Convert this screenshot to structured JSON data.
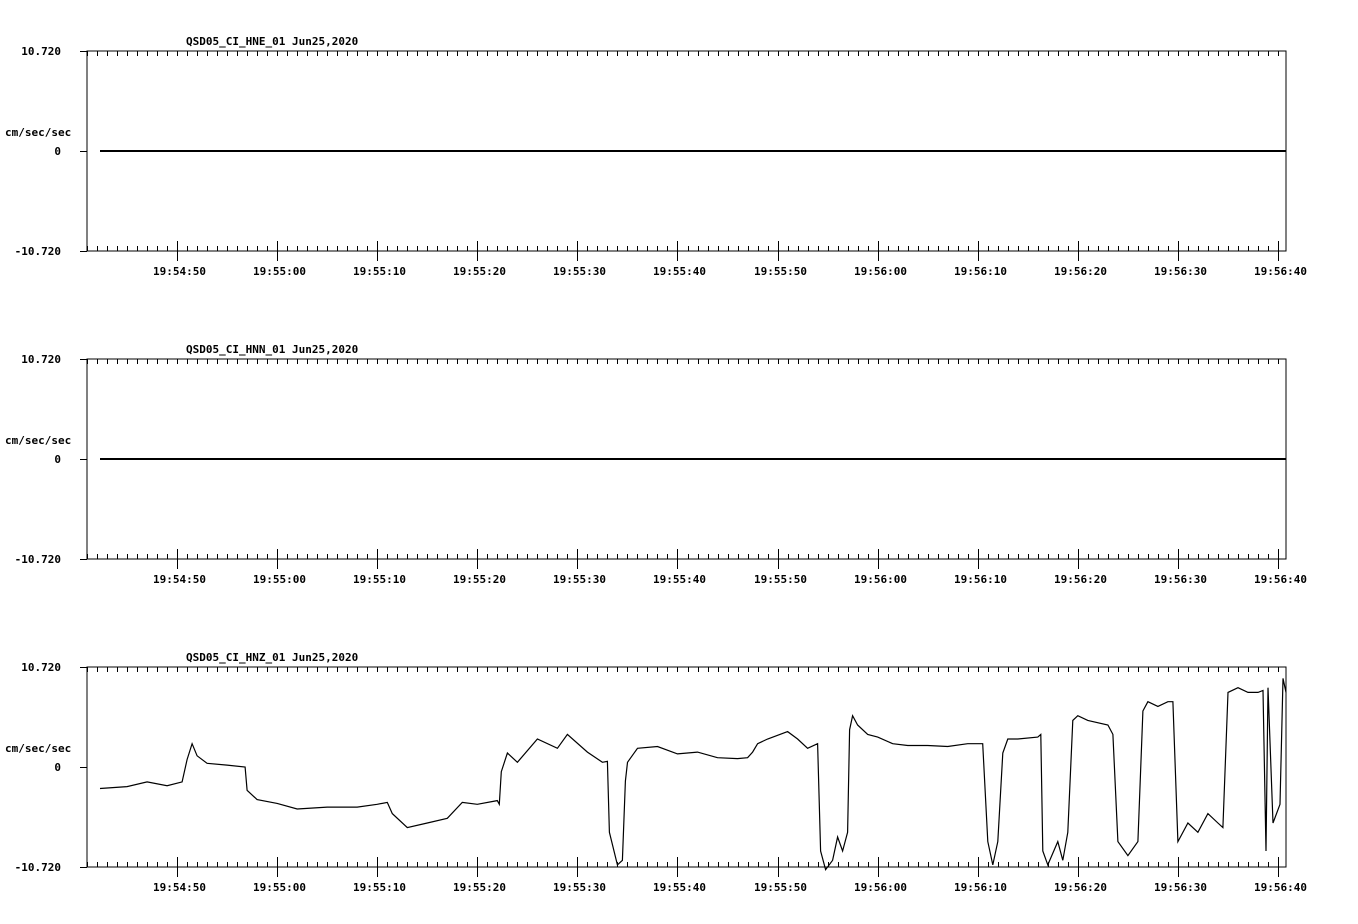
{
  "chart_data": [
    {
      "type": "line",
      "title": "QSD05_CI_HNE_01  Jun25,2020",
      "ylabel": "cm/sec/sec",
      "ylim": [
        -10.72,
        10.72
      ],
      "ytick_labels": [
        "10.720",
        "0",
        "-10.720"
      ],
      "xlim_seconds": [
        -9.0,
        110.8
      ],
      "xtick_labels": [
        "19:54:50",
        "19:55:00",
        "19:55:10",
        "19:55:20",
        "19:55:30",
        "19:55:40",
        "19:55:50",
        "19:56:00",
        "19:56:10",
        "19:56:20",
        "19:56:30",
        "19:56:40"
      ],
      "series": [
        {
          "points": [
            [
              -7.7,
              0
            ],
            [
              110.8,
              0
            ]
          ]
        }
      ]
    },
    {
      "type": "line",
      "title": "QSD05_CI_HNN_01  Jun25,2020",
      "ylabel": "cm/sec/sec",
      "ylim": [
        -10.72,
        10.72
      ],
      "ytick_labels": [
        "10.720",
        "0",
        "-10.720"
      ],
      "xlim_seconds": [
        -9.0,
        110.8
      ],
      "xtick_labels": [
        "19:54:50",
        "19:55:00",
        "19:55:10",
        "19:55:20",
        "19:55:30",
        "19:55:40",
        "19:55:50",
        "19:56:00",
        "19:56:10",
        "19:56:20",
        "19:56:30",
        "19:56:40"
      ],
      "series": [
        {
          "points": [
            [
              -7.7,
              0
            ],
            [
              110.8,
              0
            ]
          ]
        }
      ]
    },
    {
      "type": "line",
      "title": "QSD05_CI_HNZ_01  Jun25,2020",
      "ylabel": "cm/sec/sec",
      "ylim": [
        -10.72,
        10.72
      ],
      "ytick_labels": [
        "10.720",
        "0",
        "-10.720"
      ],
      "xlim_seconds": [
        -9.0,
        110.8
      ],
      "xtick_labels": [
        "19:54:50",
        "19:55:00",
        "19:55:10",
        "19:55:20",
        "19:55:30",
        "19:55:40",
        "19:55:50",
        "19:56:00",
        "19:56:10",
        "19:56:20",
        "19:56:30",
        "19:56:40"
      ],
      "series": [
        {
          "points": [
            [
              -7.7,
              -2.3
            ],
            [
              -5.0,
              -2.1
            ],
            [
              -3.0,
              -1.6
            ],
            [
              -1.0,
              -2.0
            ],
            [
              0.5,
              -1.6
            ],
            [
              1.0,
              0.8
            ],
            [
              1.5,
              2.5
            ],
            [
              2.0,
              1.2
            ],
            [
              3.0,
              0.4
            ],
            [
              5.0,
              0.2
            ],
            [
              6.8,
              0.0
            ],
            [
              7.0,
              -2.5
            ],
            [
              8.0,
              -3.5
            ],
            [
              10.0,
              -3.9
            ],
            [
              12.0,
              -4.5
            ],
            [
              15.0,
              -4.3
            ],
            [
              18.0,
              -4.3
            ],
            [
              20.0,
              -4.0
            ],
            [
              21.0,
              -3.8
            ],
            [
              21.5,
              -5.0
            ],
            [
              23.0,
              -6.5
            ],
            [
              25.0,
              -6.0
            ],
            [
              27.0,
              -5.5
            ],
            [
              28.5,
              -3.8
            ],
            [
              30.0,
              -4.0
            ],
            [
              32.0,
              -3.6
            ],
            [
              32.2,
              -4.0
            ],
            [
              32.4,
              -0.5
            ],
            [
              33.0,
              1.5
            ],
            [
              34.0,
              0.5
            ],
            [
              36.0,
              3.0
            ],
            [
              38.0,
              2.0
            ],
            [
              39.0,
              3.5
            ],
            [
              41.0,
              1.6
            ],
            [
              42.5,
              0.5
            ],
            [
              43.0,
              0.6
            ],
            [
              43.2,
              -7.0
            ],
            [
              44.0,
              -10.5
            ],
            [
              44.5,
              -10.0
            ],
            [
              44.8,
              -1.5
            ],
            [
              45.0,
              0.5
            ],
            [
              46.0,
              2.0
            ],
            [
              48.0,
              2.2
            ],
            [
              50.0,
              1.4
            ],
            [
              52.0,
              1.6
            ],
            [
              54.0,
              1.0
            ],
            [
              56.0,
              0.9
            ],
            [
              57.0,
              1.0
            ],
            [
              57.5,
              1.6
            ],
            [
              58.0,
              2.5
            ],
            [
              59.0,
              3.0
            ],
            [
              60.0,
              3.4
            ],
            [
              61.0,
              3.8
            ],
            [
              62.0,
              3.0
            ],
            [
              63.0,
              2.0
            ],
            [
              64.0,
              2.5
            ],
            [
              64.3,
              -9.0
            ],
            [
              64.8,
              -11.0
            ],
            [
              65.5,
              -10.0
            ],
            [
              66.0,
              -7.5
            ],
            [
              66.5,
              -9.0
            ],
            [
              67.0,
              -7.0
            ],
            [
              67.2,
              4.0
            ],
            [
              67.5,
              5.5
            ],
            [
              68.0,
              4.5
            ],
            [
              69.0,
              3.5
            ],
            [
              70.0,
              3.2
            ],
            [
              71.5,
              2.5
            ],
            [
              73.0,
              2.3
            ],
            [
              75.0,
              2.3
            ],
            [
              77.0,
              2.2
            ],
            [
              79.0,
              2.5
            ],
            [
              80.0,
              2.5
            ],
            [
              80.5,
              2.5
            ],
            [
              81.0,
              -8.0
            ],
            [
              81.5,
              -10.5
            ],
            [
              82.0,
              -8.0
            ],
            [
              82.5,
              1.5
            ],
            [
              83.0,
              3.0
            ],
            [
              84.0,
              3.0
            ],
            [
              86.0,
              3.2
            ],
            [
              86.3,
              3.5
            ],
            [
              86.5,
              -9.0
            ],
            [
              87.0,
              -10.5
            ],
            [
              88.0,
              -8.0
            ],
            [
              88.5,
              -10.0
            ],
            [
              89.0,
              -7.0
            ],
            [
              89.5,
              5.0
            ],
            [
              90.0,
              5.5
            ],
            [
              91.0,
              5.0
            ],
            [
              93.0,
              4.5
            ],
            [
              93.5,
              3.5
            ],
            [
              94.0,
              -8.0
            ],
            [
              95.0,
              -9.5
            ],
            [
              96.0,
              -8.0
            ],
            [
              96.5,
              6.0
            ],
            [
              97.0,
              7.0
            ],
            [
              98.0,
              6.5
            ],
            [
              99.0,
              7.0
            ],
            [
              99.5,
              7.0
            ],
            [
              100.0,
              -8.0
            ],
            [
              101.0,
              -6.0
            ],
            [
              102.0,
              -7.0
            ],
            [
              103.0,
              -5.0
            ],
            [
              104.0,
              -6.0
            ],
            [
              104.5,
              -6.5
            ],
            [
              105.0,
              8.0
            ],
            [
              106.0,
              8.5
            ],
            [
              107.0,
              8.0
            ],
            [
              108.0,
              8.0
            ],
            [
              108.5,
              8.2
            ],
            [
              108.8,
              -9.0
            ],
            [
              109.0,
              8.5
            ],
            [
              109.5,
              -6.0
            ],
            [
              110.2,
              -4.0
            ],
            [
              110.5,
              9.5
            ],
            [
              110.8,
              8.0
            ]
          ]
        }
      ]
    }
  ]
}
